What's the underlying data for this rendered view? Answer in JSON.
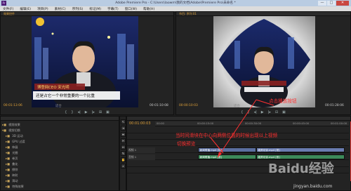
{
  "window": {
    "app_icon_label": "Pr",
    "title": "Adobe Premiere Pro - C:\\Users\\laowm\\我的文档\\Adobe\\Premiere Pro\\未命名 *",
    "buttons": [
      "—",
      "□",
      "✕"
    ]
  },
  "menu": [
    "文件(F)",
    "编辑(E)",
    "项目(P)",
    "素材(C)",
    "序列(S)",
    "标记(M)",
    "字幕(T)",
    "窗口(W)",
    "帮助(H)"
  ],
  "source_monitor": {
    "tab": "效果控件",
    "caption_name": "博登网CEO 宋光明",
    "subtitle": "还是占它一个非常重要的一个比重",
    "timecode": "00:01:13:06",
    "fit": "适合",
    "duration": "00:01:10:08"
  },
  "program_monitor": {
    "tab": "节目: 序列 01",
    "timecode": "00:00:10:03",
    "fit": "适合",
    "duration": "00:01:28:06"
  },
  "project": {
    "rows": [
      {
        "name": "视频效果",
        "kind": "folder"
      },
      {
        "name": "视频切换",
        "kind": "folder"
      },
      {
        "name": "3D 运动",
        "kind": "folder"
      },
      {
        "name": "GPU 过渡",
        "kind": "folder"
      },
      {
        "name": "伸展",
        "kind": "folder"
      },
      {
        "name": "光圈",
        "kind": "folder"
      },
      {
        "name": "卷页",
        "kind": "folder"
      },
      {
        "name": "叠化",
        "kind": "folder"
      },
      {
        "name": "擦除",
        "kind": "folder"
      },
      {
        "name": "映射",
        "kind": "folder"
      },
      {
        "name": "滑动",
        "kind": "folder"
      },
      {
        "name": "特殊效果",
        "kind": "folder"
      }
    ]
  },
  "timeline": {
    "timecode": "00:01:00:03",
    "ruler": [
      "00:00",
      "00:00:15:00",
      "00:00:30:00",
      "00:00:45:00",
      "00:01:00:00"
    ],
    "tracks": [
      {
        "name": "视频 1",
        "clips": [
          {
            "label": "新闻联播.mp4 [视]",
            "start": 0.22,
            "end": 0.52,
            "color": "#5b6fa0"
          },
          {
            "label": "嘉宾访谈.mp4 [视]",
            "start": 0.52,
            "end": 0.98,
            "color": "#6a7cb0"
          }
        ]
      },
      {
        "name": "音频 1",
        "clips": [
          {
            "label": "新闻联播.mp4 [音]",
            "start": 0.22,
            "end": 0.52,
            "color": "#3d8a5a"
          },
          {
            "label": "嘉宾访谈.mp4 [音]",
            "start": 0.52,
            "end": 0.98,
            "color": "#3d8a5a"
          }
        ]
      }
    ]
  },
  "annotations": {
    "top": "点击播放按钮",
    "middle_line1": "当时间滑块在中心向两侧位置的时候出现以上视频",
    "middle_line2": "切换预览"
  },
  "watermark": {
    "main": "Baidu经验",
    "sub": "jingyan.baidu.com"
  },
  "colors": {
    "accent_timecode": "#e0a23a",
    "annotation": "#ff3030",
    "playhead": "#dd3333"
  }
}
